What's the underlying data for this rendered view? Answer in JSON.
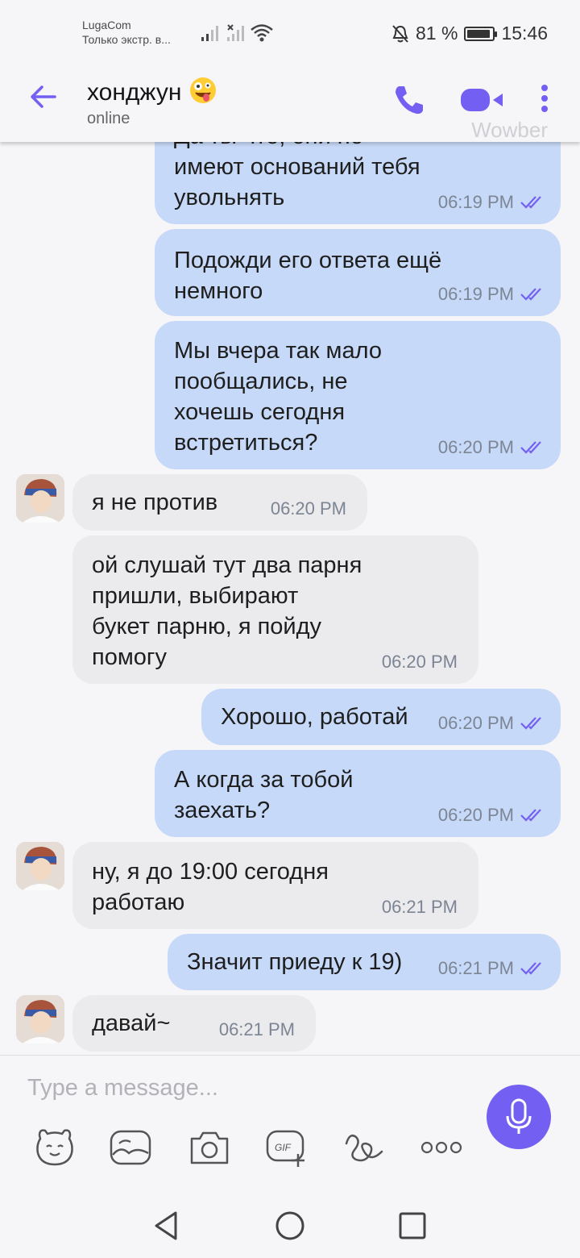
{
  "status_bar": {
    "carrier": "LugaCom",
    "carrier_sub": "Только экстр. в...",
    "battery": "81 %",
    "time": "15:46"
  },
  "header": {
    "name": "хонджун",
    "status": "online",
    "watermark": "Wowber"
  },
  "messages": [
    {
      "dir": "out",
      "text": "Да ты что, они не\nимеют оснований тебя\nувольнять",
      "time": "06:19 PM"
    },
    {
      "dir": "out",
      "text": "Подожди его ответа ещё\nнемного",
      "time": "06:19 PM"
    },
    {
      "dir": "out",
      "text": "Мы вчера так мало\nпообщались, не\nхочешь сегодня\nвстретиться?",
      "time": "06:20 PM"
    },
    {
      "dir": "in",
      "text": "я не против",
      "time": "06:20 PM"
    },
    {
      "dir": "in",
      "text": "ой слушай тут два парня\nпришли, выбирают\nбукет парню, я пойду\nпомогу",
      "time": "06:20 PM"
    },
    {
      "dir": "out",
      "text": "Хорошо, работай",
      "time": "06:20 PM"
    },
    {
      "dir": "out",
      "text": "А когда за тобой\nзаехать?",
      "time": "06:20 PM"
    },
    {
      "dir": "in",
      "text": "ну, я до 19:00 сегодня\nработаю",
      "time": "06:21 PM"
    },
    {
      "dir": "out",
      "text": "Значит приеду к 19)",
      "time": "06:21 PM"
    },
    {
      "dir": "in",
      "text": "давай~",
      "time": "06:21 PM"
    }
  ],
  "composer": {
    "placeholder": "Type a message..."
  },
  "colors": {
    "accent": "#7360f2",
    "outgoing_bubble": "#c7d9f8",
    "incoming_bubble": "#ebeaed"
  }
}
